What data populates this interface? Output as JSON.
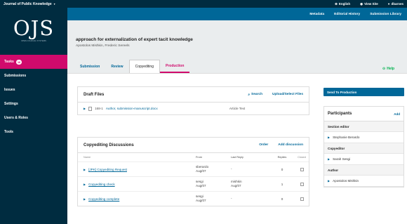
{
  "topbar": {
    "site_name": "Journal of Public Knowledge",
    "language": "English",
    "view_site": "View Site",
    "user": "dbarnes"
  },
  "logo": {
    "text": "OJS",
    "tagline": "OPEN JOURNAL SYSTEMS"
  },
  "sidebar": {
    "items": [
      {
        "label": "Tasks",
        "badge": "16"
      },
      {
        "label": "Submissions"
      },
      {
        "label": "Issues"
      },
      {
        "label": "Settings"
      },
      {
        "label": "Users & Roles"
      },
      {
        "label": "Tools"
      }
    ]
  },
  "header": {
    "metadata": "Metadata",
    "editorial_history": "Editorial History",
    "submission_library": "Submission Library"
  },
  "submission": {
    "title": "approach for externalization of expert tacit knowledge",
    "authors": "Apostolos Mishkin, Frederic Sereels"
  },
  "tabs": [
    "Submission",
    "Review",
    "Copyediting",
    "Production"
  ],
  "help_label": "Help",
  "draft_files": {
    "title": "Draft Files",
    "search_label": "Search",
    "upload_label": "Upload/Select Files",
    "files": [
      {
        "id": "168-1",
        "name": "Author, submission-manuscript.docx",
        "genre": "Article Text"
      }
    ]
  },
  "discussions": {
    "title": "Copyediting Discussions",
    "order_label": "Order",
    "add_label": "Add discussion",
    "columns": [
      "Name",
      "From",
      "Last Reply",
      "Replies",
      "Closed"
    ],
    "rows": [
      {
        "name": "[JPK] Copyediting Request",
        "from": "sberardo",
        "from_date": "Aug/07",
        "last_reply": "-",
        "last_date": "",
        "replies": "0"
      },
      {
        "name": "Copyediting check",
        "from": "sesgi",
        "from_date": "Aug/07",
        "last_reply": "mishkin",
        "last_date": "Aug/07",
        "replies": "1"
      },
      {
        "name": "Copyediting complete",
        "from": "sesgi",
        "from_date": "Aug/07",
        "last_reply": "-",
        "last_date": "",
        "replies": "0"
      }
    ]
  },
  "send_to_production": "Send To Production",
  "participants": {
    "title": "Participants",
    "add_label": "Add",
    "groups": [
      {
        "role": "Section editor",
        "members": [
          "Stephanie Berardo"
        ]
      },
      {
        "role": "Copyeditor",
        "members": [
          "Sarah Sesgi"
        ]
      },
      {
        "role": "Author",
        "members": [
          "Apostolos Mishkin"
        ]
      }
    ]
  }
}
